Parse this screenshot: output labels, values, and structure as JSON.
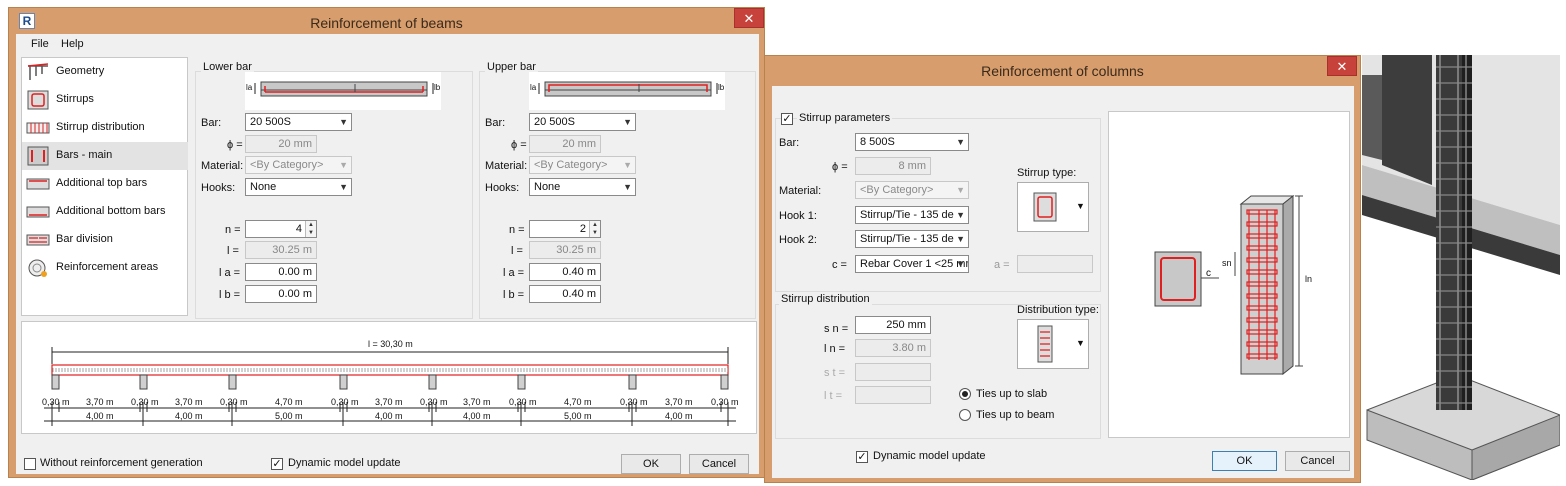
{
  "beams": {
    "title": "Reinforcement of beams",
    "close": "✕",
    "menu": [
      "File",
      "Help"
    ],
    "nav": [
      {
        "label": "Geometry",
        "icon": "geometry-icon"
      },
      {
        "label": "Stirrups",
        "icon": "stirrups-icon"
      },
      {
        "label": "Stirrup distribution",
        "icon": "stirrup-distribution-icon"
      },
      {
        "label": "Bars - main",
        "icon": "bars-main-icon",
        "selected": true
      },
      {
        "label": "Additional top bars",
        "icon": "additional-top-bars-icon"
      },
      {
        "label": "Additional bottom bars",
        "icon": "additional-bottom-bars-icon"
      },
      {
        "label": "Bar division",
        "icon": "bar-division-icon"
      },
      {
        "label": "Reinforcement areas",
        "icon": "reinforcement-areas-icon"
      }
    ],
    "lower": {
      "title": "Lower bar",
      "la_label": "la",
      "lb_label": "lb",
      "bar_label": "Bar:",
      "bar": "20 500S",
      "phi_label": "ϕ =",
      "phi": "20 mm",
      "material_label": "Material:",
      "material": "<By Category>",
      "hooks_label": "Hooks:",
      "hooks": "None",
      "n_label": "n =",
      "n": "4",
      "l_label": "l =",
      "l": "30.25 m",
      "la_field_label": "l a =",
      "la": "0.00 m",
      "lb_field_label": "l b =",
      "lb": "0.00 m"
    },
    "upper": {
      "title": "Upper bar",
      "la_label": "la",
      "lb_label": "lb",
      "bar_label": "Bar:",
      "bar": "20 500S",
      "phi_label": "ϕ =",
      "phi": "20 mm",
      "material_label": "Material:",
      "material": "<By Category>",
      "hooks_label": "Hooks:",
      "hooks": "None",
      "n_label": "n =",
      "n": "2",
      "l_label": "l =",
      "l": "30.25 m",
      "la_field_label": "l a =",
      "la": "0.40 m",
      "lb_field_label": "l b =",
      "lb": "0.40 m"
    },
    "elevation": {
      "total": "l = 30,30 m",
      "supports": [
        "0,30 m",
        "0,30 m",
        "0,30 m",
        "0,30 m",
        "0,30 m",
        "0,30 m",
        "0,30 m",
        "0,30 m"
      ],
      "clear_spans": [
        "3,70 m",
        "3,70 m",
        "4,70 m",
        "3,70 m",
        "3,70 m",
        "4,70 m",
        "3,70 m"
      ],
      "axis_spans": [
        "4,00 m",
        "4,00 m",
        "5,00 m",
        "4,00 m",
        "4,00 m",
        "5,00 m",
        "4,00 m"
      ]
    },
    "without_reinforcement": "Without reinforcement generation",
    "dynamic_update": "Dynamic model update",
    "ok": "OK",
    "cancel": "Cancel"
  },
  "columns": {
    "title": "Reinforcement of columns",
    "close": "✕",
    "stirrup_params": "Stirrup parameters",
    "bar_label": "Bar:",
    "bar": "8 500S",
    "phi_label": "ϕ =",
    "phi": "8 mm",
    "material_label": "Material:",
    "material": "<By Category>",
    "hook1_label": "Hook 1:",
    "hook1": "Stirrup/Tie - 135 de",
    "hook2_label": "Hook 2:",
    "hook2": "Stirrup/Tie - 135 de",
    "c_label": "c =",
    "c": "Rebar Cover 1 <25 mr",
    "a_label": "a =",
    "stirrup_type": "Stirrup type:",
    "stirrup_distribution": "Stirrup distribution",
    "sn_label": "s n =",
    "sn": "250 mm",
    "ln_label": "l n =",
    "ln": "3.80 m",
    "st_label": "s t =",
    "lt_label": "l t =",
    "distribution_type": "Distribution type:",
    "ties_slab": "Ties up to slab",
    "ties_beam": "Ties up to beam",
    "preview_c": "c",
    "preview_sn": "sn",
    "preview_ln": "ln",
    "dynamic_update": "Dynamic model update",
    "ok": "OK",
    "cancel": "Cancel"
  },
  "colors": {
    "accent": "#e02020",
    "frame": "#d89d6c",
    "client": "#f0f0f0"
  }
}
